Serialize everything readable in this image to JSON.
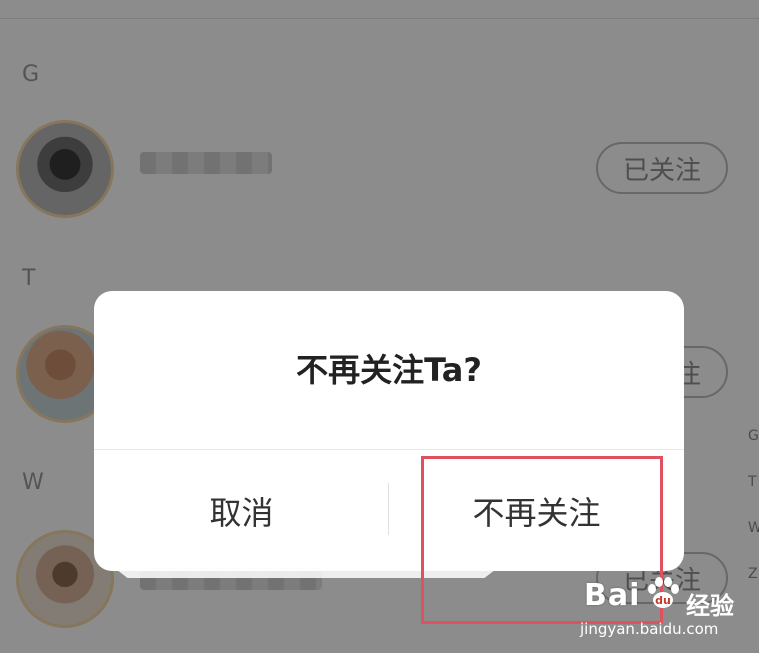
{
  "contacts": {
    "sections": [
      {
        "letter": "G",
        "follow_label": "已关注"
      },
      {
        "letter": "T",
        "follow_label": "已关注"
      },
      {
        "letter": "W",
        "follow_label": "已关注"
      }
    ]
  },
  "index_bar": [
    "G",
    "T",
    "W",
    "Z"
  ],
  "dialog": {
    "title": "不再关注Ta?",
    "cancel_label": "取消",
    "confirm_label": "不再关注"
  },
  "watermark": {
    "brand": "Bai",
    "brand_cn": "经验",
    "url": "jingyan.baidu.com"
  },
  "colors": {
    "highlight": "#e0505f",
    "overlay": "rgba(0,0,0,0.45)",
    "avatar_ring": "#f4d7a6"
  }
}
